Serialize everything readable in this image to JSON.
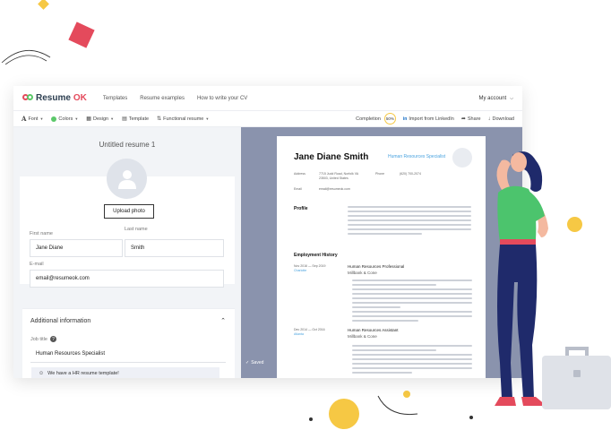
{
  "nav": {
    "brand_resume": "Resume",
    "brand_ok": "OK",
    "links": [
      "Templates",
      "Resume examples",
      "How to write your CV"
    ],
    "account": "My account"
  },
  "toolbar": {
    "font": "Font",
    "colors": "Colors",
    "design": "Design",
    "template": "Template",
    "template_name": "Functional resume",
    "completion_label": "Completion",
    "completion_value": "50%",
    "import": "Import from LinkedIn",
    "share": "Share",
    "download": "Download"
  },
  "editor": {
    "title": "Untitled resume 1",
    "upload_photo": "Upload photo",
    "first_name_label": "First name",
    "first_name_value": "Jane Diane",
    "last_name_label": "Last name",
    "last_name_value": "Smith",
    "email_label": "E-mail",
    "email_value": "email@resumeok.com",
    "additional_info": "Additional information",
    "job_title_label": "Job title",
    "job_title_value": "Human Resources Specialist",
    "hint": "We have a HR resume template!",
    "saved": "Saved"
  },
  "resume": {
    "name": "Jane Diane Smith",
    "job_title": "Human Resources Specialist",
    "address_label": "Address",
    "address_value": "7715 Judd Road, Norfolk VA 23503, United States",
    "email_label": "Email",
    "email_value": "email@resumeok.com",
    "phone_label": "Phone",
    "phone_value": "(620) 700-2074",
    "profile_heading": "Profile",
    "employment_heading": "Employment History",
    "job1_dates": "Nov 2016 — Sep 2019",
    "job1_location": "Charlotte",
    "job1_title": "Human Resources Professional",
    "job1_company": "Millbank & Cone",
    "job2_dates": "Dec 2014 — Oct 2016",
    "job2_location": "Atlanta",
    "job2_title": "Human Resources Assistant",
    "job2_company": "Millbank & Cone"
  },
  "colors": {
    "brand_red": "#e44a5c",
    "brand_green": "#5cc86a",
    "preview_bg": "#8a93ad",
    "accent_yellow": "#f6c844",
    "link_blue": "#4aa3df"
  }
}
